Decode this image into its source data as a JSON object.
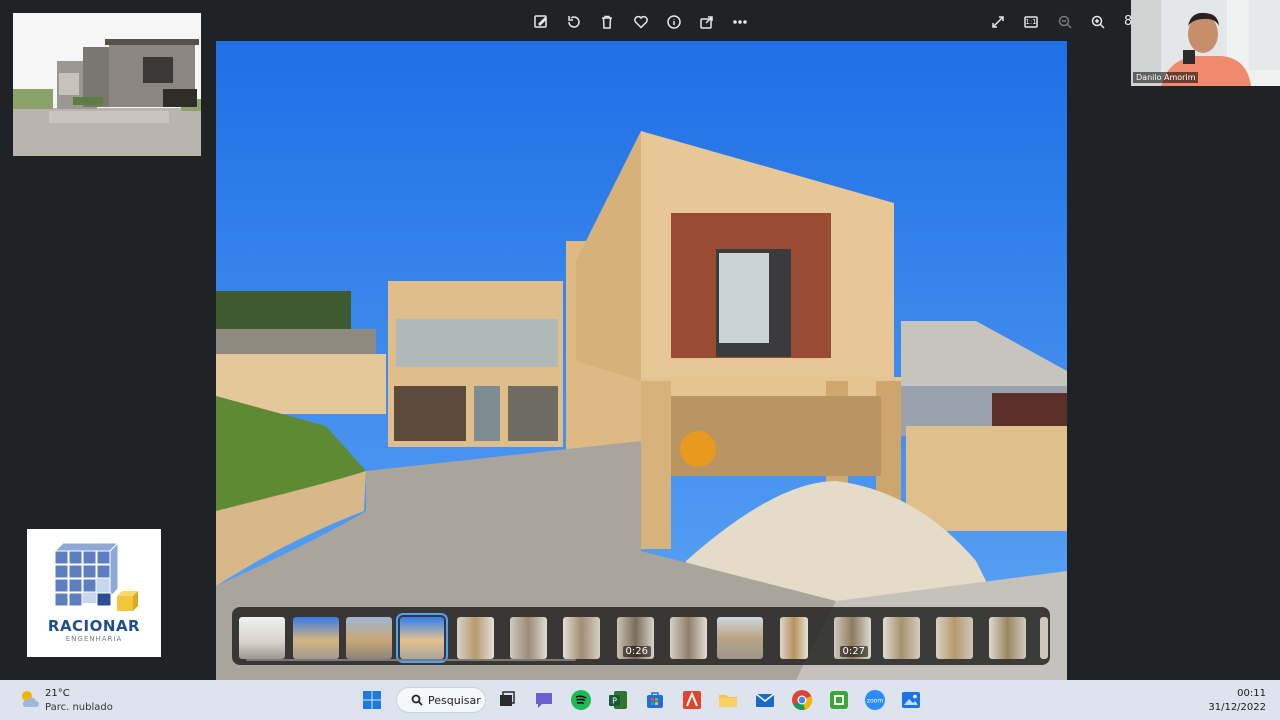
{
  "viewer": {
    "toolbar": {
      "edit_icon": "edit-image-icon",
      "rotate_icon": "rotate-icon",
      "delete_icon": "trash-icon",
      "favorite_icon": "heart-icon",
      "info_icon": "info-icon",
      "share_icon": "share-icon",
      "more_icon": "more-icon",
      "fullscreen_icon": "expand-icon",
      "actual_size_label": "1:1",
      "zoom_out_icon": "zoom-out-icon",
      "zoom_in_icon": "zoom-in-icon",
      "zoom_value": "8"
    },
    "filmstrip": {
      "thumbnails": [
        {
          "duration": ""
        },
        {
          "duration": ""
        },
        {
          "duration": ""
        },
        {
          "duration": "",
          "selected": true
        },
        {
          "duration": ""
        },
        {
          "duration": ""
        },
        {
          "duration": ""
        },
        {
          "duration": "0:26"
        },
        {
          "duration": ""
        },
        {
          "duration": ""
        },
        {
          "duration": ""
        },
        {
          "duration": "0:27"
        },
        {
          "duration": ""
        },
        {
          "duration": ""
        },
        {
          "duration": ""
        }
      ]
    }
  },
  "logo": {
    "name": "RACIONAR",
    "subtitle": "ENGENHARIA"
  },
  "webcam": {
    "participant_name": "Danilo Amorim"
  },
  "taskbar": {
    "weather": {
      "temp": "21°C",
      "desc": "Parc. nublado"
    },
    "search_label": "Pesquisar",
    "clock": {
      "time": "00:11",
      "date": "31/12/2022"
    },
    "apps": [
      "windows-start-icon",
      "search-icon",
      "task-view-icon",
      "teams-chat-icon",
      "spotify-icon",
      "project-icon",
      "store-icon",
      "autocad-icon",
      "file-explorer-icon",
      "mail-icon",
      "chrome-icon",
      "camtasia-icon",
      "zoom-icon",
      "photos-icon"
    ]
  },
  "colors": {
    "sky": "#2f7ff0",
    "wall": "#e3c28f",
    "brick": "#9a4b33",
    "selection": "#4aa3ff",
    "logo_blue": "#1f4e8c"
  }
}
